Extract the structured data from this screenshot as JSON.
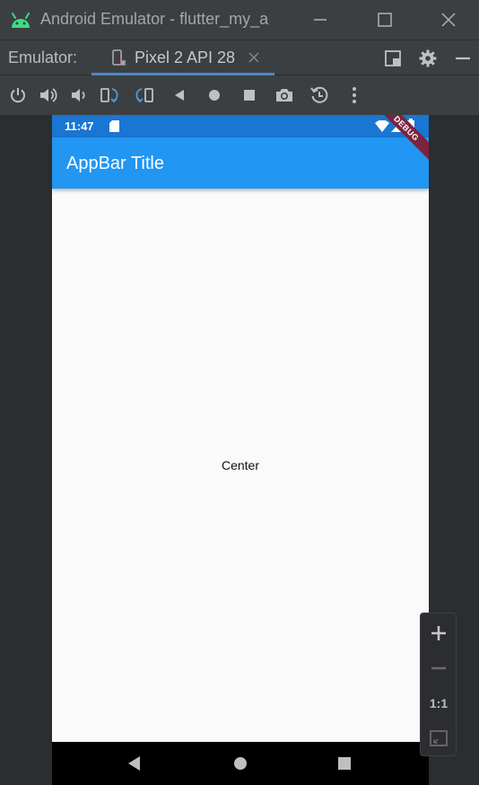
{
  "window": {
    "title": "Android Emulator - flutter_my_a",
    "icons": [
      "android-icon",
      "minimize-icon",
      "maximize-icon",
      "close-icon"
    ]
  },
  "tabbar": {
    "label": "Emulator:",
    "active_tab": "Pixel 2 API 28"
  },
  "toolbar": {
    "icons": [
      "power-icon",
      "volume-up-icon",
      "volume-down-icon",
      "rotate-left-icon",
      "rotate-right-icon",
      "back-icon",
      "home-icon",
      "overview-icon",
      "camera-icon",
      "replay-icon",
      "more-icon"
    ]
  },
  "device": {
    "status_time": "11:47",
    "appbar_title": "AppBar Title",
    "debug_banner": "DEBUG",
    "body_text": "Center"
  },
  "zoom": {
    "one_to_one": "1:1"
  },
  "colors": {
    "statusbar": "#1976d2",
    "appbar": "#2196f3",
    "debug_banner": "#7a2440",
    "tab_underline": "#4a88c7"
  }
}
